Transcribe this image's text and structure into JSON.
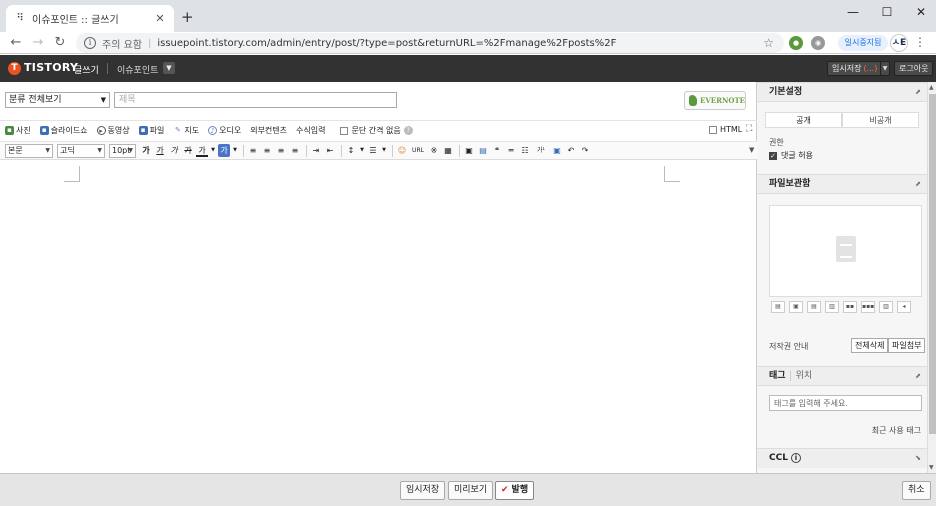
{
  "browser": {
    "tab_title": "이슈포인트 :: 글쓰기",
    "new_tab": "+",
    "security_label": "주의 요함",
    "url": "issuepoint.tistory.com/admin/entry/post/?type=post&returnURL=%2Fmanage%2Fposts%2F",
    "pause_label": "일시중지됨",
    "profile_initials": "ㅅE"
  },
  "topbar": {
    "logo": "TISTORY",
    "logo_mark": "T",
    "write_label": "글쓰기",
    "blog_name": "이슈포인트",
    "temp_save_label": "임시저장",
    "temp_save_count": "(...)",
    "logout_label": "로그아웃"
  },
  "editor": {
    "category": "분류 전체보기",
    "title_placeholder": "제목",
    "evernote_label": "EVERNOTE",
    "toolbar1": [
      {
        "label": "사진",
        "icon": "photo-icon",
        "color": "#4a8a3c"
      },
      {
        "label": "슬라이드쇼",
        "icon": "slideshow-icon",
        "color": "#3f6fb5"
      },
      {
        "label": "동영상",
        "icon": "video-icon",
        "color": "#555555"
      },
      {
        "label": "파일",
        "icon": "file-icon",
        "color": "#3b6db8"
      },
      {
        "label": "지도",
        "icon": "map-icon",
        "color": "#6a88c6"
      },
      {
        "label": "오디오",
        "icon": "audio-icon",
        "color": "#6a88c6"
      },
      {
        "label": "외부컨텐츠",
        "icon": "",
        "color": ""
      },
      {
        "label": "수식입력",
        "icon": "",
        "color": ""
      }
    ],
    "paragraph_spacing_label": "문단 간격 없음",
    "html_label": "HTML",
    "style_select": "본문",
    "font_select": "고딕",
    "size_select": "10pt",
    "url_label": "URL"
  },
  "sidebar": {
    "basic_settings": "기본설정",
    "public_label": "공개",
    "private_label": "비공개",
    "permission_label": "권한",
    "allow_comments": "댓글 허용",
    "file_storage": "파일보관함",
    "copyright_label": "저작권 안내",
    "delete_all": "전체삭제",
    "attach_file": "파일첨부",
    "tag_label": "태그",
    "location_label": "위치",
    "tag_placeholder": "태그를 입력해 주세요.",
    "recent_tags": "최근 사용 태그",
    "ccl_label": "CCL"
  },
  "bottom": {
    "temp_save": "임시저장",
    "preview": "미리보기",
    "publish": "발행",
    "cancel": "취소"
  }
}
